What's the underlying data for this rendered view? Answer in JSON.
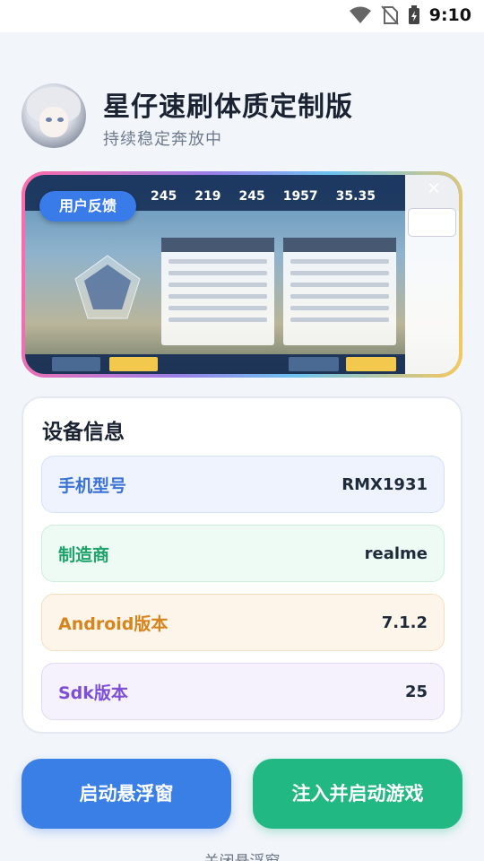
{
  "status_bar": {
    "time": "9:10",
    "icons": [
      "wifi-icon",
      "no-sim-icon",
      "battery-charging-icon"
    ]
  },
  "header": {
    "title": "星仔速刷体质定制版",
    "subtitle": "持续稳定奔放中"
  },
  "banner": {
    "feedback_label": "用户反馈",
    "close_icon": "close-icon"
  },
  "device_info": {
    "title": "设备信息",
    "rows": [
      {
        "label": "手机型号",
        "value": "RMX1931"
      },
      {
        "label": "制造商",
        "value": "realme"
      },
      {
        "label": "Android版本",
        "value": "7.1.2"
      },
      {
        "label": "Sdk版本",
        "value": "25"
      }
    ]
  },
  "actions": {
    "start_float_label": "启动悬浮窗",
    "inject_start_label": "注入并启动游戏",
    "close_float_label": "关闭悬浮窗"
  },
  "colors": {
    "primary_blue": "#3a7fe6",
    "primary_green": "#22b883"
  }
}
